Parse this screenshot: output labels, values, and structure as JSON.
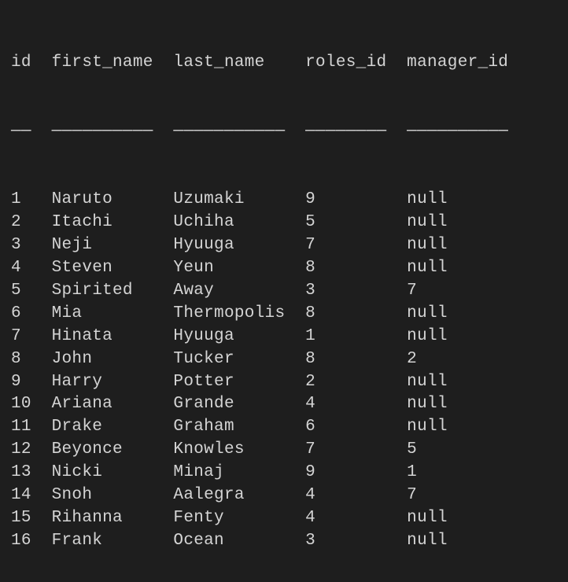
{
  "chart_data": {
    "type": "table",
    "columns": [
      "id",
      "first_name",
      "last_name",
      "roles_id",
      "manager_id"
    ],
    "rows": [
      {
        "id": "1",
        "first_name": "Naruto",
        "last_name": "Uzumaki",
        "roles_id": "9",
        "manager_id": "null"
      },
      {
        "id": "2",
        "first_name": "Itachi",
        "last_name": "Uchiha",
        "roles_id": "5",
        "manager_id": "null"
      },
      {
        "id": "3",
        "first_name": "Neji",
        "last_name": "Hyuuga",
        "roles_id": "7",
        "manager_id": "null"
      },
      {
        "id": "4",
        "first_name": "Steven",
        "last_name": "Yeun",
        "roles_id": "8",
        "manager_id": "null"
      },
      {
        "id": "5",
        "first_name": "Spirited",
        "last_name": "Away",
        "roles_id": "3",
        "manager_id": "7"
      },
      {
        "id": "6",
        "first_name": "Mia",
        "last_name": "Thermopolis",
        "roles_id": "8",
        "manager_id": "null"
      },
      {
        "id": "7",
        "first_name": "Hinata",
        "last_name": "Hyuuga",
        "roles_id": "1",
        "manager_id": "null"
      },
      {
        "id": "8",
        "first_name": "John",
        "last_name": "Tucker",
        "roles_id": "8",
        "manager_id": "2"
      },
      {
        "id": "9",
        "first_name": "Harry",
        "last_name": "Potter",
        "roles_id": "2",
        "manager_id": "null"
      },
      {
        "id": "10",
        "first_name": "Ariana",
        "last_name": "Grande",
        "roles_id": "4",
        "manager_id": "null"
      },
      {
        "id": "11",
        "first_name": "Drake",
        "last_name": "Graham",
        "roles_id": "6",
        "manager_id": "null"
      },
      {
        "id": "12",
        "first_name": "Beyonce",
        "last_name": "Knowles",
        "roles_id": "7",
        "manager_id": "5"
      },
      {
        "id": "13",
        "first_name": "Nicki",
        "last_name": "Minaj",
        "roles_id": "9",
        "manager_id": "1"
      },
      {
        "id": "14",
        "first_name": "Snoh",
        "last_name": "Aalegra",
        "roles_id": "4",
        "manager_id": "7"
      },
      {
        "id": "15",
        "first_name": "Rihanna",
        "last_name": "Fenty",
        "roles_id": "4",
        "manager_id": "null"
      },
      {
        "id": "16",
        "first_name": "Frank",
        "last_name": "Ocean",
        "roles_id": "3",
        "manager_id": "null"
      }
    ]
  },
  "column_widths": {
    "id": 4,
    "first_name": 12,
    "last_name": 13,
    "roles_id": 10,
    "manager_id": 10
  }
}
